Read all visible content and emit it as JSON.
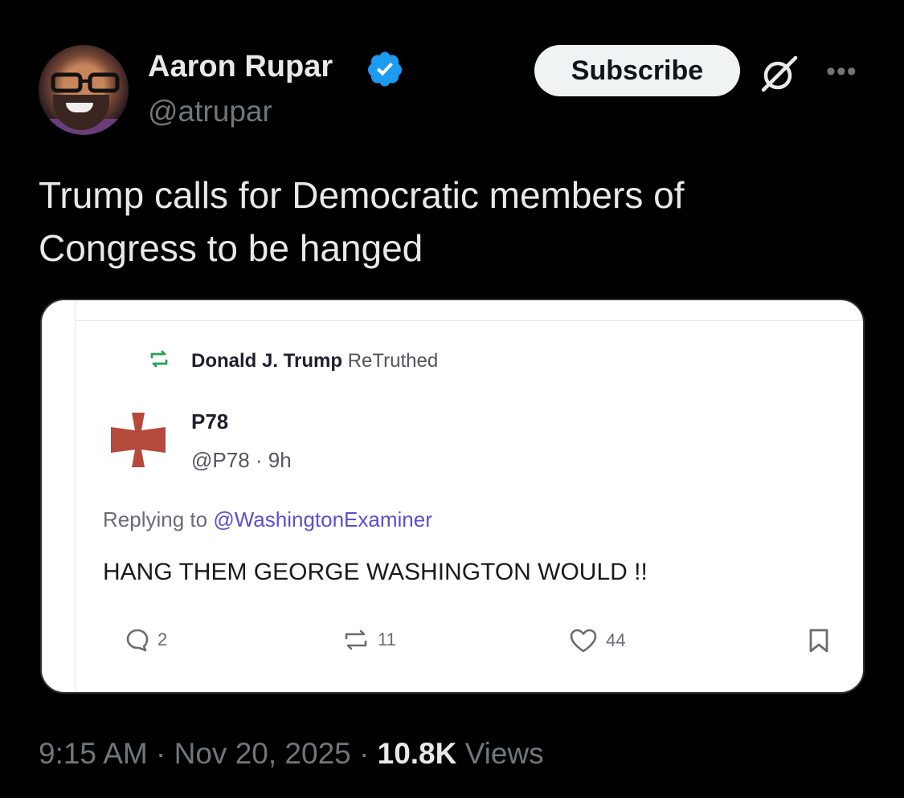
{
  "author": {
    "name": "Aaron Rupar",
    "handle": "@atrupar",
    "verified": true
  },
  "header": {
    "subscribe_label": "Subscribe",
    "grok_icon": "grok-icon",
    "more_label": "•••"
  },
  "tweet": {
    "text": "Trump calls for Democratic members of Congress to be hanged"
  },
  "embedded_post": {
    "retruth_by": "Donald J. Trump",
    "retruth_label": "ReTruthed",
    "author_name": "P78",
    "author_handle_time": "@P78 · 9h",
    "replying_prefix": "Replying to ",
    "replying_to": "@WashingtonExaminer",
    "text": "HANG THEM GEORGE WASHINGTON WOULD !!",
    "replies": "2",
    "retruths": "11",
    "likes": "44"
  },
  "meta": {
    "time_date": "9:15 AM · Nov 20, 2025 · ",
    "views_count": "10.8K",
    "views_label": " Views"
  },
  "colors": {
    "background": "#000000",
    "verified_blue": "#1d9bf0",
    "retruth_green": "#22a35a",
    "cross_red": "#b5493c",
    "link_purple": "#5b4ecf"
  }
}
